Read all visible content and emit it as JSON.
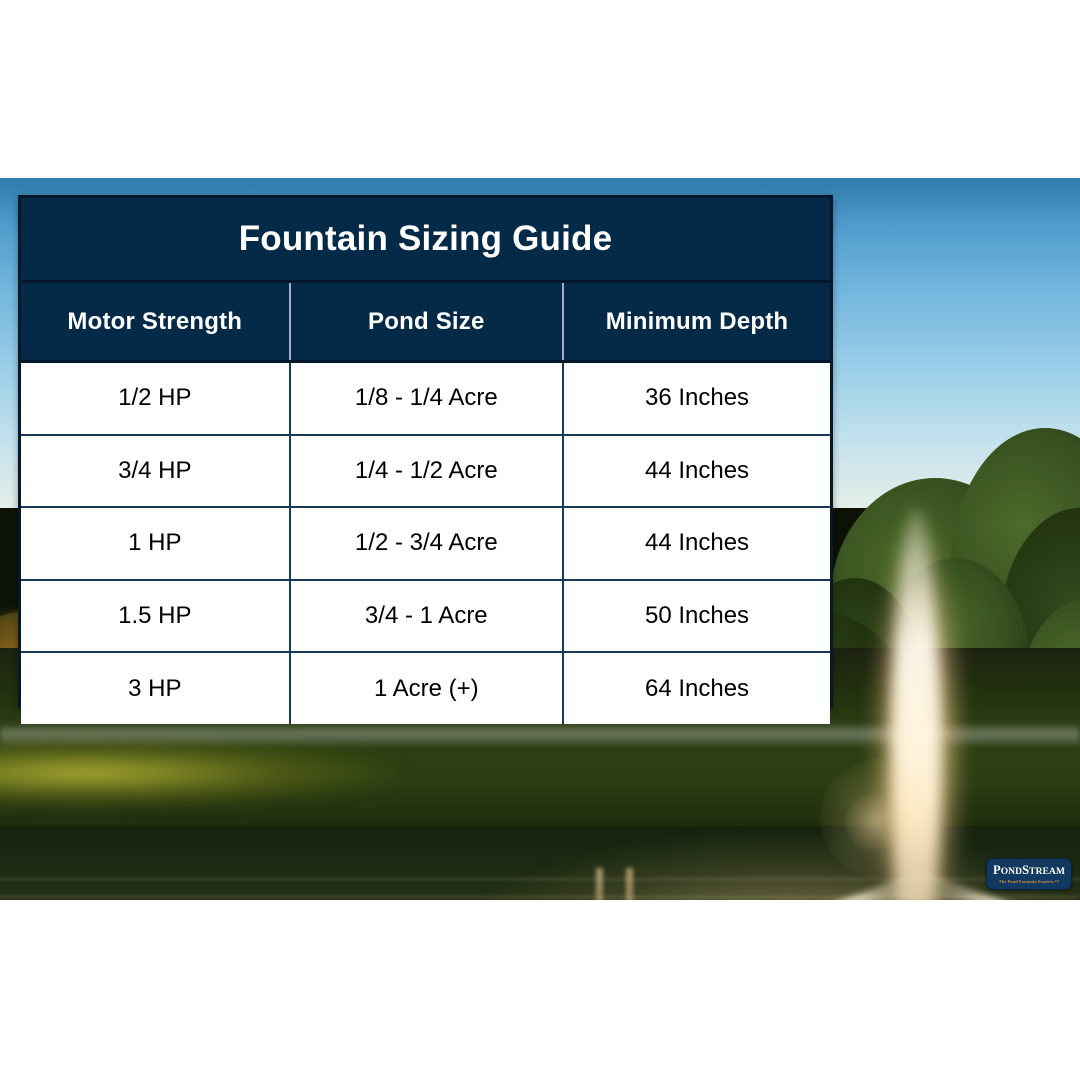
{
  "table": {
    "title": "Fountain Sizing Guide",
    "columns": [
      "Motor Strength",
      "Pond Size",
      "Minimum Depth"
    ],
    "rows": [
      [
        "1/2 HP",
        "1/8 - 1/4 Acre",
        "36 Inches"
      ],
      [
        "3/4 HP",
        "1/4 - 1/2 Acre",
        "44 Inches"
      ],
      [
        "1 HP",
        "1/2 - 3/4 Acre",
        "44 Inches"
      ],
      [
        "1.5 HP",
        "3/4 - 1 Acre",
        "50 Inches"
      ],
      [
        "3 HP",
        "1 Acre (+)",
        "64 Inches"
      ]
    ]
  },
  "logo": {
    "brand_part1": "P",
    "brand_part2": "OND",
    "brand_part3": "S",
    "brand_part4": "TREAM",
    "tagline": "The Pond Fountain Experts ™"
  },
  "colors": {
    "navy_header": "#042a47",
    "navy_border": "#07182b",
    "cell_border": "#183a55",
    "logo_navy": "#12395f",
    "logo_tagline": "#d9933c",
    "sky_blue": "#72b6dd"
  },
  "scene": {
    "description": "Pond fountain at sunset with trees"
  }
}
